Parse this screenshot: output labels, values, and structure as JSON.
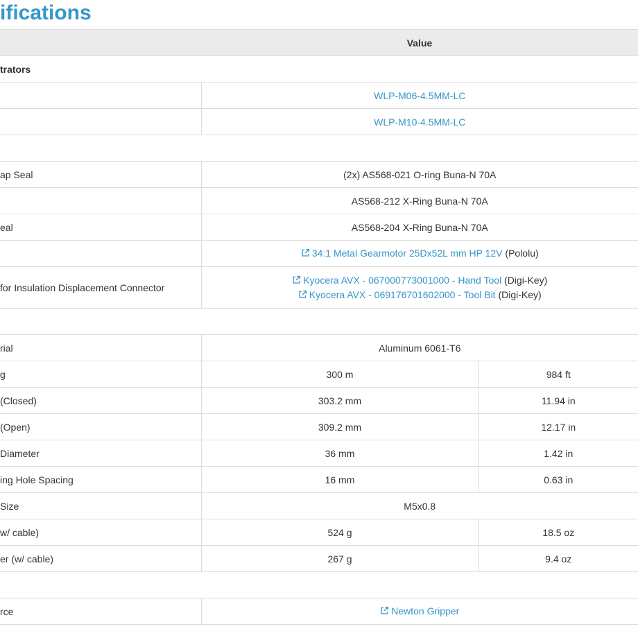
{
  "title": "ifications",
  "header": {
    "col_name": "",
    "col_value": "Value"
  },
  "rows": [
    {
      "type": "section",
      "label": "trators"
    },
    {
      "type": "link",
      "label": "",
      "value": "WLP-M06-4.5MM-LC"
    },
    {
      "type": "link",
      "label": "",
      "value": "WLP-M10-4.5MM-LC"
    },
    {
      "type": "blank"
    },
    {
      "type": "single",
      "label": "ap Seal",
      "value": "(2x) AS568-021 O-ring Buna-N 70A"
    },
    {
      "type": "single",
      "label": "",
      "value": "AS568-212 X-Ring Buna-N 70A"
    },
    {
      "type": "single",
      "label": "eal",
      "value": "AS568-204 X-Ring Buna-N 70A"
    },
    {
      "type": "extlink",
      "label": "",
      "links": [
        {
          "text": "34:1 Metal Gearmotor 25Dx52L mm HP 12V",
          "suffix": " (Pololu)"
        }
      ]
    },
    {
      "type": "extlink",
      "label": "for Insulation Displacement Connector",
      "links": [
        {
          "text": "Kyocera AVX - 067000773001000 - Hand Tool",
          "suffix": " (Digi-Key)"
        },
        {
          "text": "Kyocera AVX - 069176701602000 - Tool Bit",
          "suffix": " (Digi-Key)"
        }
      ]
    },
    {
      "type": "blank"
    },
    {
      "type": "single",
      "label": "rial",
      "value": "Aluminum 6061-T6"
    },
    {
      "type": "dual",
      "label": "g",
      "metric": "300 m",
      "imperial": "984 ft"
    },
    {
      "type": "dual",
      "label": " (Closed)",
      "metric": "303.2 mm",
      "imperial": "11.94 in"
    },
    {
      "type": "dual",
      "label": " (Open)",
      "metric": "309.2 mm",
      "imperial": "12.17 in"
    },
    {
      "type": "dual",
      "label": "Diameter",
      "metric": "36 mm",
      "imperial": "1.42 in"
    },
    {
      "type": "dual",
      "label": "ing Hole Spacing",
      "metric": "16 mm",
      "imperial": "0.63 in"
    },
    {
      "type": "single",
      "label": " Size",
      "value": "M5x0.8"
    },
    {
      "type": "dual",
      "label": "w/ cable)",
      "metric": "524 g",
      "imperial": "18.5 oz"
    },
    {
      "type": "dual",
      "label": "er (w/ cable)",
      "metric": "267 g",
      "imperial": "9.4 oz"
    },
    {
      "type": "blank"
    },
    {
      "type": "extlink",
      "label": "rce",
      "links": [
        {
          "text": "Newton Gripper",
          "suffix": ""
        }
      ]
    }
  ],
  "colors": {
    "accent": "#3596c9",
    "header_bg": "#ebebeb",
    "border": "#dcdcdc"
  },
  "icons": {
    "external_link": "external-link-icon"
  }
}
